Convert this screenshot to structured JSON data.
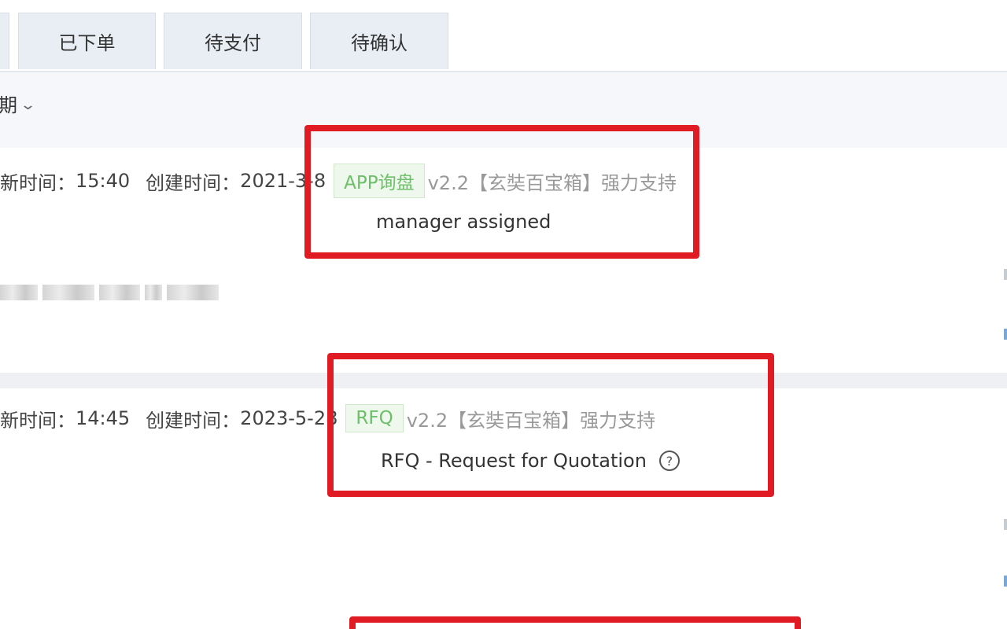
{
  "tabs": [
    {
      "label": "已下单"
    },
    {
      "label": "待支付"
    },
    {
      "label": "待确认"
    }
  ],
  "sort": {
    "label": "期"
  },
  "orders": [
    {
      "updated_label": "新时间：",
      "updated_value": "15:40",
      "created_label": "创建时间：",
      "created_value": "2021-3-8",
      "source_badge": "APP询盘",
      "support_text": "v2.2【玄奘百宝箱】强力支持",
      "sub_label": "manager assigned"
    },
    {
      "updated_label": "新时间：",
      "updated_value": "14:45",
      "created_label": "创建时间：",
      "created_value": "2023-5-28",
      "source_badge": "RFQ",
      "support_text": "v2.2【玄奘百宝箱】强力支持",
      "sub_label": "RFQ - Request for Quotation",
      "help_icon": "?"
    }
  ],
  "colors": {
    "highlight_box": "#e01b24",
    "badge_text": "#6dbf6a",
    "badge_bg": "#eef8ec",
    "tab_bg": "#e9eef4"
  }
}
